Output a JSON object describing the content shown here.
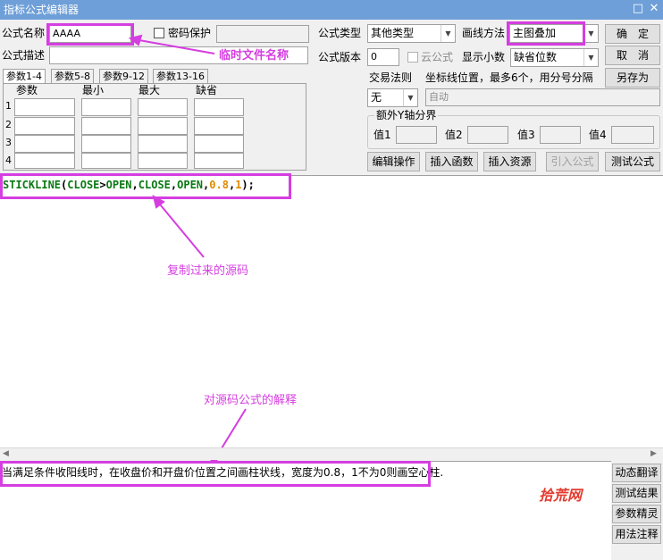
{
  "window": {
    "title": "指标公式编辑器",
    "btn_max": "□",
    "btn_close": "✕"
  },
  "form": {
    "name_label": "公式名称",
    "name_value": "AAAA",
    "password_label": "密码保护",
    "desc_label": "公式描述",
    "type_label": "公式类型",
    "type_value": "其他类型",
    "draw_label": "画线方法",
    "draw_value": "主图叠加",
    "version_label": "公式版本",
    "version_value": "0",
    "cloud_label": "云公式",
    "decimal_label": "显示小数",
    "decimal_value": "缺省位数",
    "trade_label": "交易法则",
    "trade_value": "无",
    "axis_label": "坐标线位置，最多6个，用分号分隔",
    "axis_value": "自动",
    "extra_axis_label": "额外Y轴分界",
    "extra_values": [
      "值1",
      "值2",
      "值3",
      "值4"
    ]
  },
  "tabs": [
    "参数1-4",
    "参数5-8",
    "参数9-12",
    "参数13-16"
  ],
  "params": {
    "headers": [
      "参数",
      "最小",
      "最大",
      "缺省"
    ],
    "rows": [
      "1",
      "2",
      "3",
      "4"
    ]
  },
  "buttons": {
    "ok": "确　定",
    "cancel": "取　消",
    "save_as": "另存为",
    "edit": "编辑操作",
    "insert_func": "插入函数",
    "insert_res": "插入资源",
    "import": "引入公式",
    "test": "测试公式"
  },
  "side_buttons": [
    "动态翻译",
    "测试结果",
    "参数精灵",
    "用法注释"
  ],
  "code": {
    "tokens": [
      {
        "t": "STICKLINE",
        "c": "kw"
      },
      {
        "t": "(",
        "c": "punc"
      },
      {
        "t": "CLOSE",
        "c": "kw"
      },
      {
        "t": ">",
        "c": "punc"
      },
      {
        "t": "OPEN",
        "c": "kw"
      },
      {
        "t": ",",
        "c": "punc"
      },
      {
        "t": "CLOSE",
        "c": "kw"
      },
      {
        "t": ",",
        "c": "punc"
      },
      {
        "t": "OPEN",
        "c": "kw"
      },
      {
        "t": ",",
        "c": "punc"
      },
      {
        "t": "0.8",
        "c": "num"
      },
      {
        "t": ",",
        "c": "punc"
      },
      {
        "t": "1",
        "c": "num"
      },
      {
        "t": ");",
        "c": "punc"
      }
    ]
  },
  "description": "当满足条件收阳线时，在收盘价和开盘价位置之间画柱状线，宽度为0.8，1不为0则画空心柱.",
  "annotations": {
    "temp_name": "临时文件名称",
    "copied_code": "复制过来的源码",
    "explain": "对源码公式的解释"
  },
  "watermark": "拾荒网",
  "colors": {
    "highlight": "#d53ee0",
    "keyword": "#0b7a13",
    "number": "#e08a00",
    "titlebar": "#6e9fd8"
  }
}
